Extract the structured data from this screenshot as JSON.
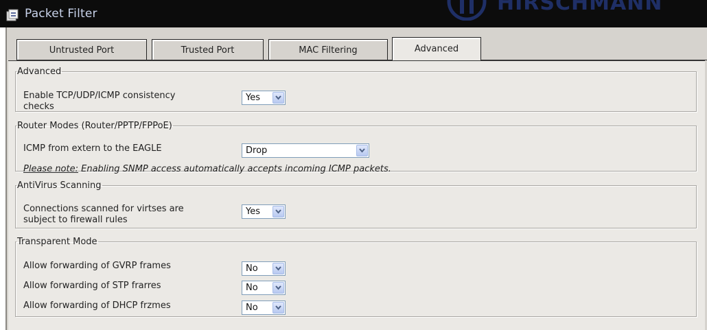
{
  "window": {
    "title": "Packet Filter",
    "title_icon": "packet-filter-icon",
    "brand_text": "HIRSCHMANN",
    "brand_icon": "hirschmann-logo-icon"
  },
  "tabs": [
    {
      "label": "Untrusted Port",
      "active": false
    },
    {
      "label": "Trusted Port",
      "active": false
    },
    {
      "label": "MAC Filtering",
      "active": false
    },
    {
      "label": "Advanced",
      "active": true
    }
  ],
  "sections": {
    "advanced": {
      "legend": "Advanced",
      "consistency": {
        "label_line1": "Enable TCP/UDP/ICMP consistency",
        "label_line2": "checks",
        "value": "Yes"
      }
    },
    "router_modes": {
      "legend": "Router Modes (Router/PPTP/FPPoE)",
      "icmp": {
        "label": "ICMP from extern to the EAGLE",
        "value": "Drop"
      },
      "note_prefix": "Please note:",
      "note_text": " Enabling SNMP access automatically accepts incoming ICMP packets."
    },
    "antivirus": {
      "legend": "AntiVirus Scanning",
      "scanned": {
        "label_line1": "Connections scanned for virtses are",
        "label_line2": "subject to firewall rules",
        "value": "Yes"
      }
    },
    "transparent": {
      "legend": "Transparent Mode",
      "gvrp": {
        "label": "Allow forwarding of GVRP frames",
        "value": "No"
      },
      "stp": {
        "label": "Allow forwarding of STP frarres",
        "value": "No"
      },
      "dhcp": {
        "label": "Allow forwarding of DHCP frzmes",
        "value": "No"
      }
    }
  },
  "colors": {
    "titlebar": "#0c0c0c",
    "title_text": "#c8d2ea",
    "panel": "#d6d3ce",
    "content": "#ebe9e5",
    "select_border": "#7f9db9",
    "arrow_button": "#c4d3f4"
  }
}
